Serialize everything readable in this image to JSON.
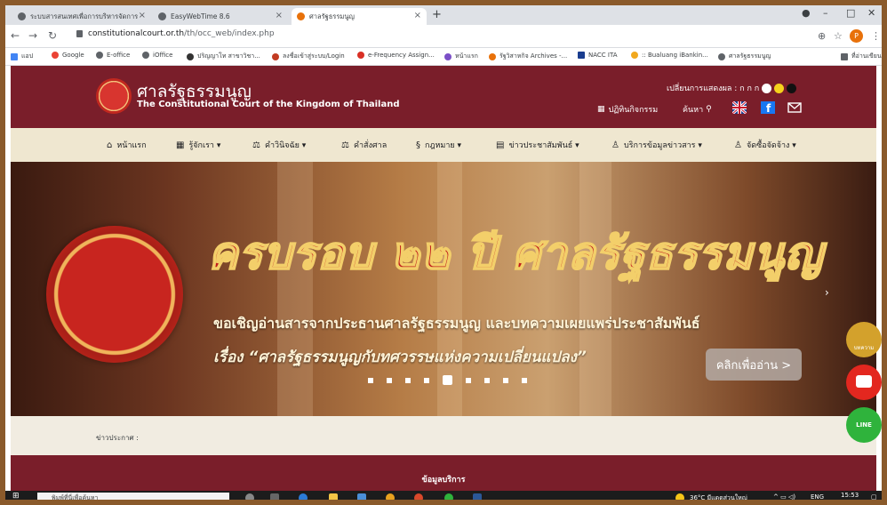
{
  "browser": {
    "tabs": [
      {
        "label": "ระบบสารสนเทศเพื่อการบริหารจัดการ",
        "active": false
      },
      {
        "label": "EasyWebTime 8.6",
        "active": false
      },
      {
        "label": "ศาลรัฐธรรมนูญ",
        "active": true
      }
    ],
    "url_host": "constitutionalcourt.or.th",
    "url_path": "/th/occ_web/index.php",
    "profile_initial": "P",
    "bookmarks": [
      "แอป",
      "Google",
      "E-office",
      "iOffice",
      "ปริญญาโท สาขาวิชา...",
      "ลงชื่อเข้าสู่ระบบ/Login",
      "e-Frequency Assign...",
      "หน้าแรก",
      "รัฐวิสาหกิจ Archives -...",
      "NACC ITA",
      ":: Bualuang iBankin...",
      "ศาลรัฐธรรมนูญ",
      "ที่อ่านเขียน"
    ]
  },
  "site": {
    "name_th": "ศาลรัฐธรรมนูญ",
    "name_en": "The Constitutional Court of the Kingdom of Thailand",
    "display_mode_label": "เปลี่ยนการแสดงผล : ก ก ก",
    "calendar_label": "ปฏิทินกิจกรรม",
    "search_label": "ค้นหา",
    "colors": {
      "brand": "#7a1e2a",
      "nav_bg": "#efe7d0",
      "accent_gold": "#f3cf6a"
    }
  },
  "nav": {
    "items": [
      {
        "label": "หน้าแรก",
        "icon": "home-icon",
        "glyph": "⌂"
      },
      {
        "label": "รู้จักเรา ▾",
        "icon": "info-icon",
        "glyph": "▦"
      },
      {
        "label": "คำวินิจฉัย ▾",
        "icon": "gavel-icon",
        "glyph": "⚖"
      },
      {
        "label": "คำสั่งศาล",
        "icon": "scale-icon",
        "glyph": "⚖"
      },
      {
        "label": "กฎหมาย ▾",
        "icon": "law-icon",
        "glyph": "§"
      },
      {
        "label": "ข่าวประชาสัมพันธ์ ▾",
        "icon": "news-icon",
        "glyph": "▤"
      },
      {
        "label": "บริการข้อมูลข่าวสาร ▾",
        "icon": "service-icon",
        "glyph": "♙"
      },
      {
        "label": "จัดซื้อจัดจ้าง ▾",
        "icon": "procurement-icon",
        "glyph": "♙"
      }
    ]
  },
  "hero": {
    "headline": "ครบรอบ ๒๒ ปี ศาลรัฐธรรมนูญ",
    "line1": "ขอเชิญอ่านสารจากประธานศาลรัฐธรรมนูญ และบทความเผยแพร่ประชาสัมพันธ์",
    "line2": "เรื่อง “ศาลรัฐธรรมนูญกับทศวรรษแห่งความเปลี่ยนแปลง”",
    "cta": "คลิกเพื่ออ่าน >",
    "slide_count": 9,
    "active_slide": 5
  },
  "announce": {
    "label": "ข่าวประกาศ :"
  },
  "services": {
    "title": "ข้อมูลบริการ"
  },
  "floating": {
    "book_label": "บทความ",
    "line_label": "LINE"
  },
  "taskbar": {
    "search_placeholder": "พิมพ์ที่นี่เพื่อค้นหา",
    "weather": "36°C มีแดดส่วนใหญ่",
    "lang": "ENG",
    "time": "15:53"
  }
}
